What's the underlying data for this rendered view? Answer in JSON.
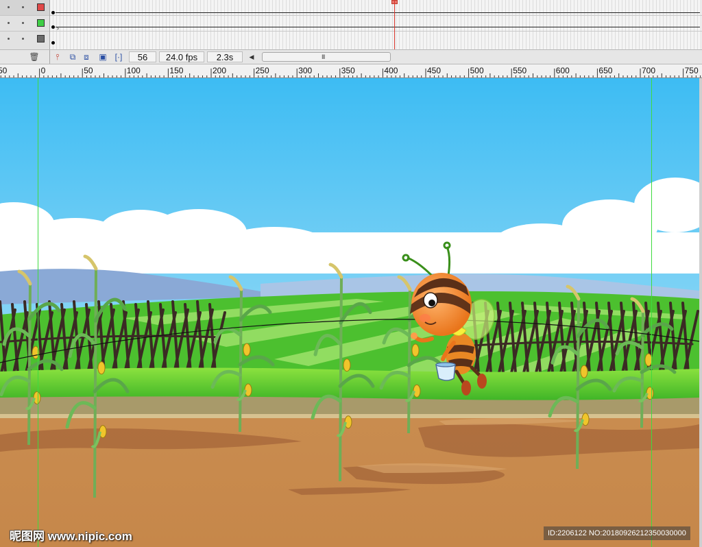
{
  "timeline": {
    "layers": [
      {
        "color": "#e04848"
      },
      {
        "color": "#3fce46"
      },
      {
        "color": "#6a6a6a"
      }
    ],
    "current_frame": "56",
    "fps": "24.0 fps",
    "elapsed_time": "2.3s",
    "scroll_grip": "III",
    "accent_color": "#d9362b"
  },
  "ruler": {
    "labels": [
      "50",
      "0",
      "50",
      "100",
      "150",
      "200",
      "250",
      "300",
      "350",
      "400",
      "450",
      "500",
      "550",
      "600",
      "650",
      "700",
      "750"
    ]
  },
  "stage": {
    "sky_top": "#3dbcf3",
    "sky_bottom": "#c9ecf8",
    "field_green": "#6ad632",
    "soil": "#c88a4b",
    "guide_color": "#3edb3e"
  },
  "watermark": {
    "site": "昵图网 www.nipic.com",
    "id": "ID:2206122 NO:20180926212350030000"
  }
}
